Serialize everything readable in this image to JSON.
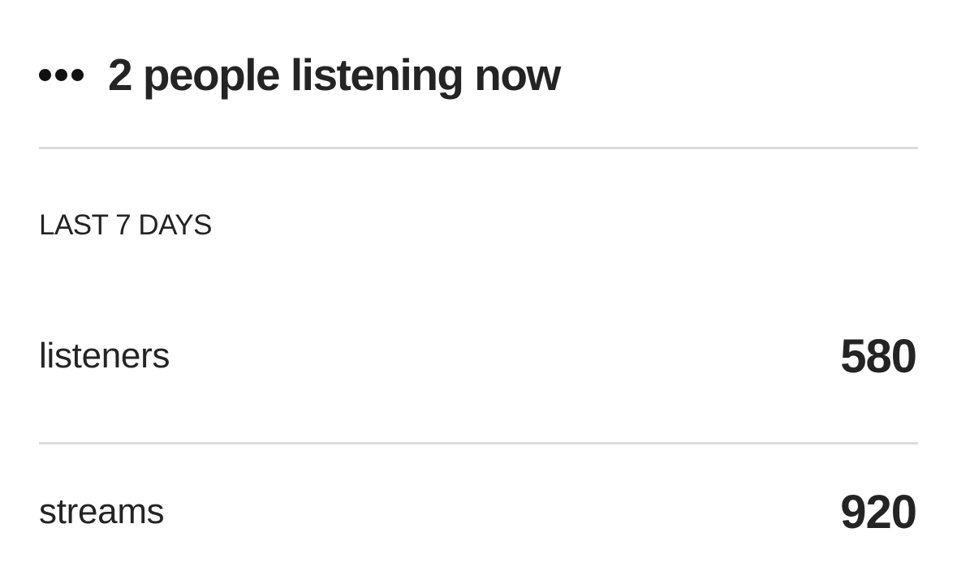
{
  "live": {
    "icon": "more-dots-icon",
    "text": "2 people listening now"
  },
  "period": {
    "label": "LAST 7 DAYS"
  },
  "stats": [
    {
      "label": "listeners",
      "value": "580"
    },
    {
      "label": "streams",
      "value": "920"
    }
  ],
  "colors": {
    "text": "#242424",
    "divider": "#dcdcdc",
    "background": "#ffffff"
  }
}
